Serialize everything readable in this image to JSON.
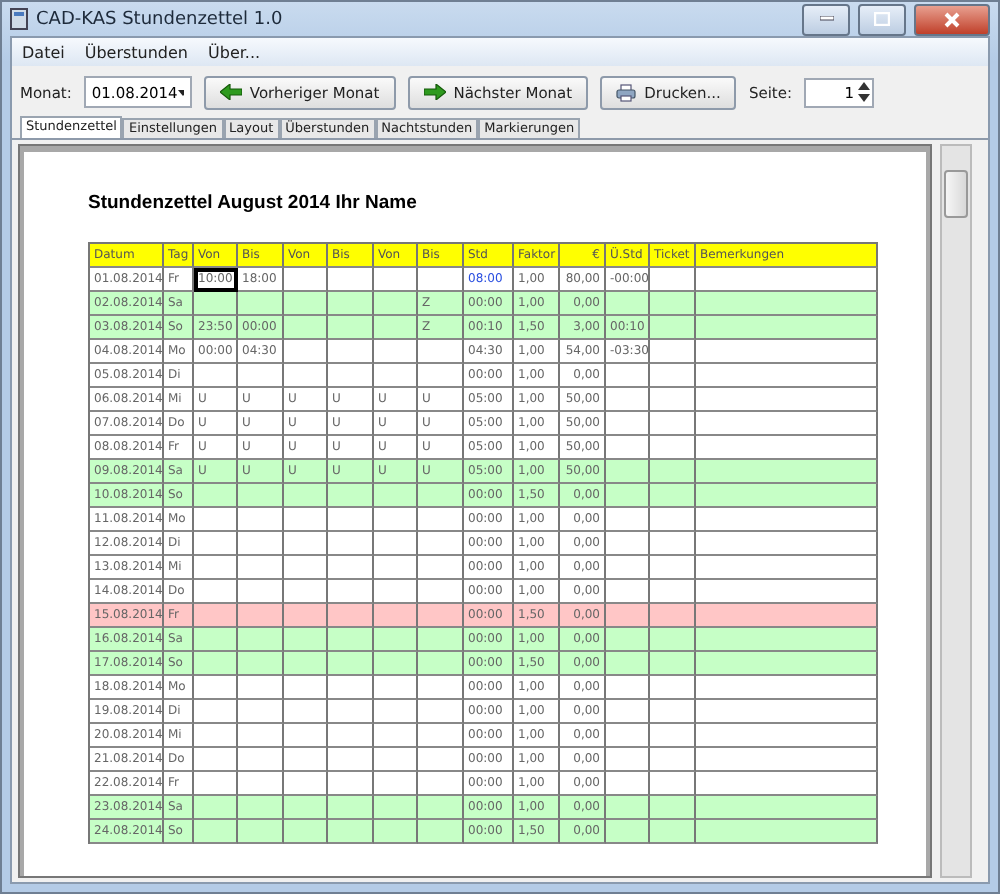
{
  "window": {
    "title": "CAD-KAS Stundenzettel 1.0"
  },
  "menu": [
    "Datei",
    "Überstunden",
    "Über..."
  ],
  "toolbar": {
    "month_label": "Monat:",
    "month_value": "01.08.2014",
    "prev": "Vorheriger Monat",
    "next": "Nächster Monat",
    "print": "Drucken...",
    "page_label": "Seite:",
    "page_value": "1"
  },
  "tabs": [
    {
      "label": "Stundenzettel",
      "selected": true
    },
    {
      "label": "Einstellungen",
      "selected": false
    },
    {
      "label": "Layout",
      "selected": false
    },
    {
      "label": "Überstunden",
      "selected": false
    },
    {
      "label": "Nachtstunden",
      "selected": false
    },
    {
      "label": "Markierungen",
      "selected": false
    }
  ],
  "sheet": {
    "title": "Stundenzettel August 2014 Ihr Name",
    "columns": [
      "Datum",
      "Tag",
      "Von",
      "Bis",
      "Von",
      "Bis",
      "Von",
      "Bis",
      "Std",
      "Faktor",
      "€",
      "Ü.Std",
      "Ticket",
      "Bemerkungen"
    ],
    "rows": [
      {
        "kind": "workday",
        "cells": [
          "01.08.2014",
          "Fr",
          {
            "text": "10:00",
            "focused": true
          },
          "18:00",
          null,
          null,
          null,
          null,
          {
            "text": "08:00",
            "color": "#2a4fe0"
          },
          "1,00",
          "80,00",
          "-00:00",
          null,
          null
        ]
      },
      {
        "kind": "weekend",
        "cells": [
          "02.08.2014",
          "Sa",
          null,
          null,
          null,
          null,
          null,
          "Z",
          "00:00",
          "1,00",
          "0,00",
          null,
          null,
          null
        ]
      },
      {
        "kind": "weekend",
        "cells": [
          "03.08.2014",
          "So",
          "23:50",
          "00:00",
          null,
          null,
          null,
          "Z",
          "00:10",
          "1,50",
          "3,00",
          "00:10",
          null,
          null
        ]
      },
      {
        "kind": "workday",
        "cells": [
          "04.08.2014",
          "Mo",
          "00:00",
          "04:30",
          null,
          null,
          null,
          null,
          "04:30",
          "1,00",
          "54,00",
          "-03:30",
          null,
          null
        ]
      },
      {
        "kind": "workday",
        "cells": [
          "05.08.2014",
          "Di",
          null,
          null,
          null,
          null,
          null,
          null,
          "00:00",
          "1,00",
          "0,00",
          null,
          null,
          null
        ]
      },
      {
        "kind": "workday",
        "cells": [
          "06.08.2014",
          "Mi",
          "U",
          "U",
          "U",
          "U",
          "U",
          "U",
          "05:00",
          "1,00",
          "50,00",
          null,
          null,
          null
        ]
      },
      {
        "kind": "workday",
        "cells": [
          "07.08.2014",
          "Do",
          "U",
          "U",
          "U",
          "U",
          "U",
          "U",
          "05:00",
          "1,00",
          "50,00",
          null,
          null,
          null
        ]
      },
      {
        "kind": "workday",
        "cells": [
          "08.08.2014",
          "Fr",
          "U",
          "U",
          "U",
          "U",
          "U",
          "U",
          "05:00",
          "1,00",
          "50,00",
          null,
          null,
          null
        ]
      },
      {
        "kind": "weekend",
        "cells": [
          "09.08.2014",
          "Sa",
          "U",
          "U",
          "U",
          "U",
          "U",
          "U",
          "05:00",
          "1,00",
          "50,00",
          null,
          null,
          null
        ]
      },
      {
        "kind": "weekend",
        "cells": [
          "10.08.2014",
          "So",
          null,
          null,
          null,
          null,
          null,
          null,
          "00:00",
          "1,50",
          "0,00",
          null,
          null,
          null
        ]
      },
      {
        "kind": "workday",
        "cells": [
          "11.08.2014",
          "Mo",
          null,
          null,
          null,
          null,
          null,
          null,
          "00:00",
          "1,00",
          "0,00",
          null,
          null,
          null
        ]
      },
      {
        "kind": "workday",
        "cells": [
          "12.08.2014",
          "Di",
          null,
          null,
          null,
          null,
          null,
          null,
          "00:00",
          "1,00",
          "0,00",
          null,
          null,
          null
        ]
      },
      {
        "kind": "workday",
        "cells": [
          "13.08.2014",
          "Mi",
          null,
          null,
          null,
          null,
          null,
          null,
          "00:00",
          "1,00",
          "0,00",
          null,
          null,
          null
        ]
      },
      {
        "kind": "workday",
        "cells": [
          "14.08.2014",
          "Do",
          null,
          null,
          null,
          null,
          null,
          null,
          "00:00",
          "1,00",
          "0,00",
          null,
          null,
          null
        ]
      },
      {
        "kind": "holiday",
        "cells": [
          "15.08.2014",
          "Fr",
          null,
          null,
          null,
          null,
          null,
          null,
          "00:00",
          "1,50",
          "0,00",
          null,
          null,
          null
        ]
      },
      {
        "kind": "weekend",
        "cells": [
          "16.08.2014",
          "Sa",
          null,
          null,
          null,
          null,
          null,
          null,
          "00:00",
          "1,00",
          "0,00",
          null,
          null,
          null
        ]
      },
      {
        "kind": "weekend",
        "cells": [
          "17.08.2014",
          "So",
          null,
          null,
          null,
          null,
          null,
          null,
          "00:00",
          "1,50",
          "0,00",
          null,
          null,
          null
        ]
      },
      {
        "kind": "workday",
        "cells": [
          "18.08.2014",
          "Mo",
          null,
          null,
          null,
          null,
          null,
          null,
          "00:00",
          "1,00",
          "0,00",
          null,
          null,
          null
        ]
      },
      {
        "kind": "workday",
        "cells": [
          "19.08.2014",
          "Di",
          null,
          null,
          null,
          null,
          null,
          null,
          "00:00",
          "1,00",
          "0,00",
          null,
          null,
          null
        ]
      },
      {
        "kind": "workday",
        "cells": [
          "20.08.2014",
          "Mi",
          null,
          null,
          null,
          null,
          null,
          null,
          "00:00",
          "1,00",
          "0,00",
          null,
          null,
          null
        ]
      },
      {
        "kind": "workday",
        "cells": [
          "21.08.2014",
          "Do",
          null,
          null,
          null,
          null,
          null,
          null,
          "00:00",
          "1,00",
          "0,00",
          null,
          null,
          null
        ]
      },
      {
        "kind": "workday",
        "cells": [
          "22.08.2014",
          "Fr",
          null,
          null,
          null,
          null,
          null,
          null,
          "00:00",
          "1,00",
          "0,00",
          null,
          null,
          null
        ]
      },
      {
        "kind": "weekend",
        "cells": [
          "23.08.2014",
          "Sa",
          null,
          null,
          null,
          null,
          null,
          null,
          "00:00",
          "1,00",
          "0,00",
          null,
          null,
          null
        ]
      },
      {
        "kind": "weekend",
        "cells": [
          "24.08.2014",
          "So",
          null,
          null,
          null,
          null,
          null,
          null,
          "00:00",
          "1,50",
          "0,00",
          null,
          null,
          null
        ]
      }
    ]
  }
}
